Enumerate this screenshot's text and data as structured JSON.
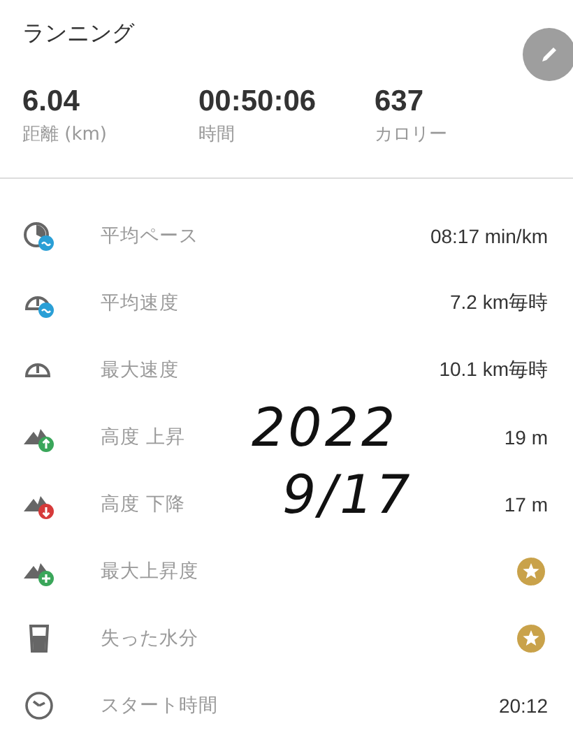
{
  "title": "ランニング",
  "stats": [
    {
      "value": "6.04",
      "label": "距離 (km)"
    },
    {
      "value": "00:50:06",
      "label": "時間"
    },
    {
      "value": "637",
      "label": "カロリー"
    }
  ],
  "rows": [
    {
      "label": "平均ペース",
      "kind": "text",
      "value": "08:17 min/km"
    },
    {
      "label": "平均速度",
      "kind": "text",
      "value": "7.2 km毎時"
    },
    {
      "label": "最大速度",
      "kind": "text",
      "value": "10.1 km毎時"
    },
    {
      "label": "高度 上昇",
      "kind": "text",
      "value": "19 m"
    },
    {
      "label": "高度 下降",
      "kind": "text",
      "value": "17 m"
    },
    {
      "label": "最大上昇度",
      "kind": "star"
    },
    {
      "label": "失った水分",
      "kind": "star"
    },
    {
      "label": "スタート時間",
      "kind": "text",
      "value": "20:12"
    }
  ],
  "annotation": [
    "2022",
    "9/17"
  ]
}
